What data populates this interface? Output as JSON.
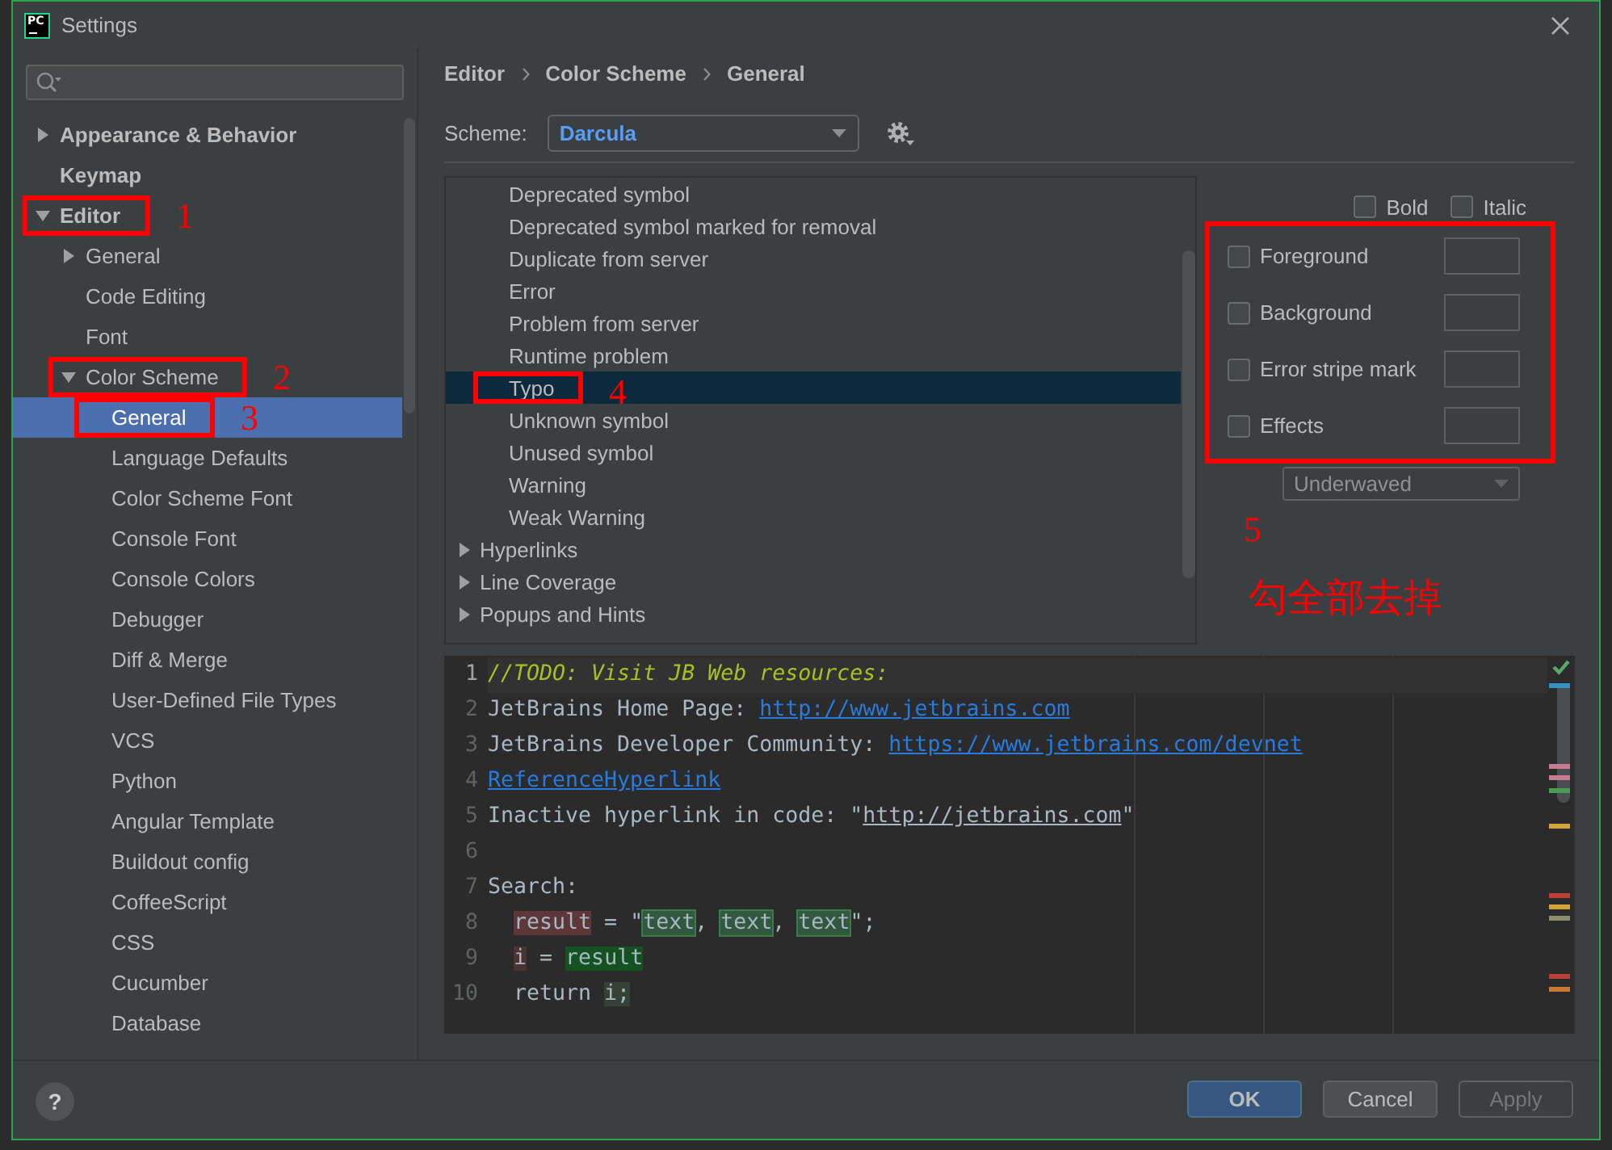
{
  "window": {
    "title": "Settings",
    "app_icon_text": "PC"
  },
  "sidebar": {
    "items": [
      {
        "label": "Appearance & Behavior",
        "expanded": false,
        "selected": false
      },
      {
        "label": "Keymap",
        "selected": false
      },
      {
        "label": "Editor",
        "expanded": true,
        "selected": false,
        "annotation": "1",
        "children": [
          {
            "label": "General",
            "expanded": false,
            "selected": false
          },
          {
            "label": "Code Editing",
            "selected": false
          },
          {
            "label": "Font",
            "selected": false
          },
          {
            "label": "Color Scheme",
            "expanded": true,
            "selected": false,
            "annotation": "2",
            "children": [
              {
                "label": "General",
                "selected": true,
                "annotation": "3"
              },
              {
                "label": "Language Defaults",
                "selected": false
              },
              {
                "label": "Color Scheme Font",
                "selected": false
              },
              {
                "label": "Console Font",
                "selected": false
              },
              {
                "label": "Console Colors",
                "selected": false
              },
              {
                "label": "Debugger",
                "selected": false
              },
              {
                "label": "Diff & Merge",
                "selected": false
              },
              {
                "label": "User-Defined File Types",
                "selected": false
              },
              {
                "label": "VCS",
                "selected": false
              },
              {
                "label": "Python",
                "selected": false
              },
              {
                "label": "Angular Template",
                "selected": false
              },
              {
                "label": "Buildout config",
                "selected": false
              },
              {
                "label": "CoffeeScript",
                "selected": false
              },
              {
                "label": "CSS",
                "selected": false
              },
              {
                "label": "Cucumber",
                "selected": false
              },
              {
                "label": "Database",
                "selected": false
              }
            ]
          }
        ]
      }
    ]
  },
  "breadcrumb": [
    "Editor",
    "Color Scheme",
    "General"
  ],
  "scheme": {
    "label": "Scheme:",
    "value": "Darcula"
  },
  "attributes": {
    "items": [
      {
        "children": [
          {
            "label": "Deprecated symbol",
            "selected": false
          },
          {
            "label": "Deprecated symbol marked for removal",
            "selected": false
          },
          {
            "label": "Duplicate from server",
            "selected": false
          },
          {
            "label": "Error",
            "selected": false
          },
          {
            "label": "Problem from server",
            "selected": false
          },
          {
            "label": "Runtime problem",
            "selected": false
          },
          {
            "label": "Typo",
            "selected": true,
            "annotation": "4"
          },
          {
            "label": "Unknown symbol",
            "selected": false
          },
          {
            "label": "Unused symbol",
            "selected": false
          },
          {
            "label": "Warning",
            "selected": false
          },
          {
            "label": "Weak Warning",
            "selected": false
          }
        ]
      },
      {
        "label": "Hyperlinks",
        "expanded": false,
        "selected": false
      },
      {
        "label": "Line Coverage",
        "expanded": false,
        "selected": false
      },
      {
        "label": "Popups and Hints",
        "expanded": false,
        "selected": false
      }
    ]
  },
  "font_style": [
    {
      "label": "Bold",
      "checked": false
    },
    {
      "label": "Italic",
      "checked": false
    }
  ],
  "color_options": {
    "annotation": "5",
    "note": "勾全部去掉",
    "items": [
      {
        "label": "Foreground",
        "checked": false
      },
      {
        "label": "Background",
        "checked": false
      },
      {
        "label": "Error stripe mark",
        "checked": false
      },
      {
        "label": "Effects",
        "checked": false
      }
    ]
  },
  "effect_type": {
    "value": "Underwaved",
    "disabled": true
  },
  "editor": {
    "lines": [
      {
        "number": "1",
        "current": true,
        "indented": false,
        "segments": [
          {
            "kind": "comment",
            "text": "//TODO: Visit JB Web resources:"
          }
        ]
      },
      {
        "number": "2",
        "current": false,
        "indented": false,
        "segments": [
          {
            "kind": "plain",
            "text": "JetBrains Home Page: "
          },
          {
            "kind": "link",
            "text": "http://www.jetbrains.com"
          }
        ]
      },
      {
        "number": "3",
        "current": false,
        "indented": false,
        "segments": [
          {
            "kind": "plain",
            "text": "JetBrains Developer Community: "
          },
          {
            "kind": "link",
            "text": "https://www.jetbrains.com/devnet"
          }
        ]
      },
      {
        "number": "4",
        "current": false,
        "indented": false,
        "segments": [
          {
            "kind": "link",
            "text": "ReferenceHyperlink"
          }
        ]
      },
      {
        "number": "5",
        "current": false,
        "indented": false,
        "segments": [
          {
            "kind": "plain",
            "text": "Inactive hyperlink in code: \""
          },
          {
            "kind": "inactive_link",
            "text": "http://jetbrains.com"
          },
          {
            "kind": "plain",
            "text": "\""
          }
        ]
      },
      {
        "number": "6",
        "current": false,
        "indented": false
      },
      {
        "number": "7",
        "current": false,
        "indented": false,
        "segments": [
          {
            "kind": "plain",
            "text": "Search:"
          }
        ]
      },
      {
        "number": "8",
        "current": false,
        "indented": true,
        "segments": [
          {
            "kind": "write_match",
            "text": "result"
          },
          {
            "kind": "plain",
            "text": " = \""
          },
          {
            "kind": "text_match",
            "text": "text"
          },
          {
            "kind": "plain",
            "text": ", "
          },
          {
            "kind": "text_match",
            "text": "text"
          },
          {
            "kind": "plain",
            "text": ", "
          },
          {
            "kind": "text_match",
            "text": "text"
          },
          {
            "kind": "plain",
            "text": "\";"
          }
        ]
      },
      {
        "number": "9",
        "current": false,
        "indented": true,
        "segments": [
          {
            "kind": "write_usage",
            "text": "i"
          },
          {
            "kind": "plain",
            "text": " = "
          },
          {
            "kind": "read_match",
            "text": "result"
          }
        ]
      },
      {
        "number": "10",
        "current": false,
        "indented": true,
        "segments": [
          {
            "kind": "plain",
            "text": "return "
          },
          {
            "kind": "read_usage",
            "text": "i;"
          }
        ]
      }
    ],
    "stripe_marks": [
      {
        "color": "#3592c4"
      },
      {
        "color": "#c77d90"
      },
      {
        "color": "#c77d90"
      },
      {
        "color": "#499c54"
      },
      {
        "color": "#d1a33a"
      },
      {
        "color": "#bc3f3c"
      },
      {
        "color": "#d1a33a"
      },
      {
        "color": "#8c8c6e"
      },
      {
        "color": "#bc3f3c"
      },
      {
        "color": "#cc7832"
      }
    ]
  },
  "footer": {
    "help": "?",
    "buttons": [
      {
        "label": "OK",
        "kind": "default",
        "disabled": false
      },
      {
        "label": "Cancel",
        "kind": "normal",
        "disabled": false
      },
      {
        "label": "Apply",
        "kind": "normal",
        "disabled": true
      }
    ]
  }
}
